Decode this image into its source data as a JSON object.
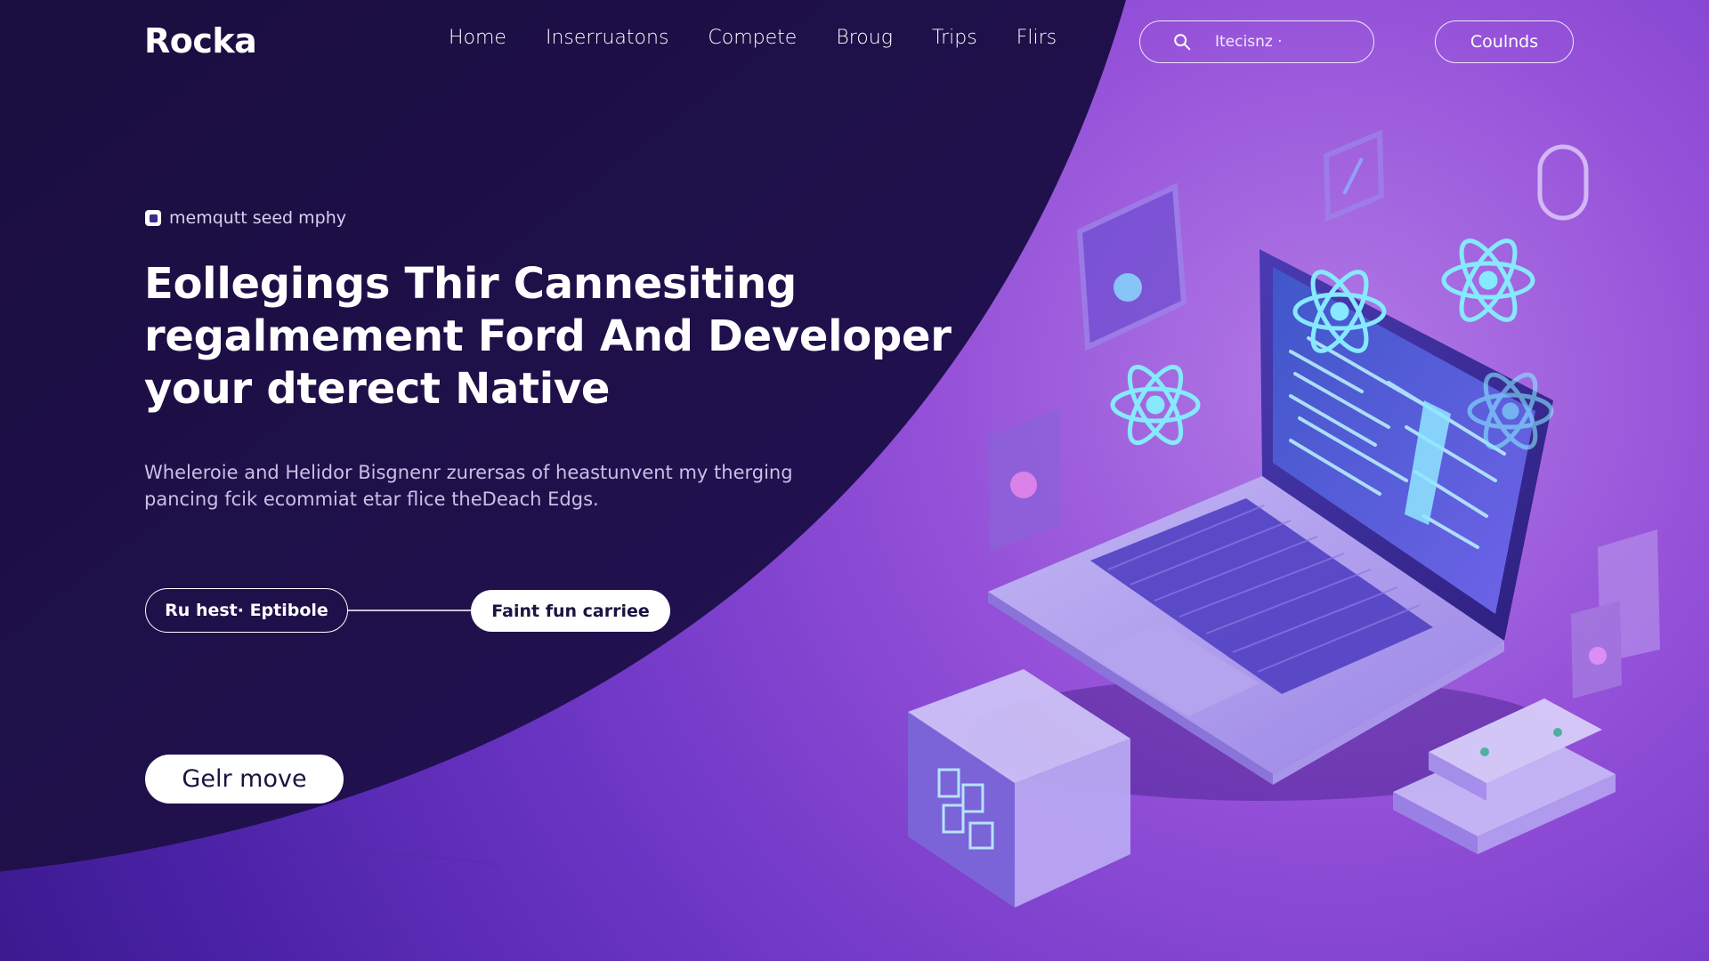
{
  "brand": {
    "logo": "Rocka"
  },
  "nav": {
    "items": [
      "Home",
      "Inserruatons",
      "Compete",
      "Broug",
      "Trips",
      "Flirs"
    ],
    "search_placeholder": "Itecisnz ·",
    "cta": "Coulnds"
  },
  "hero": {
    "eyebrow": "memqutt seed mphy",
    "headline": [
      "Eollegings Thir Cannesiting",
      "regalmement Ford And Developer",
      "your dterect Native"
    ],
    "description": [
      "Wheleroie and Helidor Bisgnenr zurersas of heastunvent my therging",
      "pancing fcik ecommiat etar flice theDeach Edgs."
    ],
    "btn_outline": "Ru hest· Eptibole",
    "btn_primary": "Faint fun carriee",
    "btn_secondary": "Gelr move"
  },
  "colors": {
    "dark_navy": "#1c0f45",
    "purple": "#6a36c7",
    "light_purple": "#b27ae6",
    "cyan": "#7fe6ff",
    "white": "#ffffff"
  }
}
